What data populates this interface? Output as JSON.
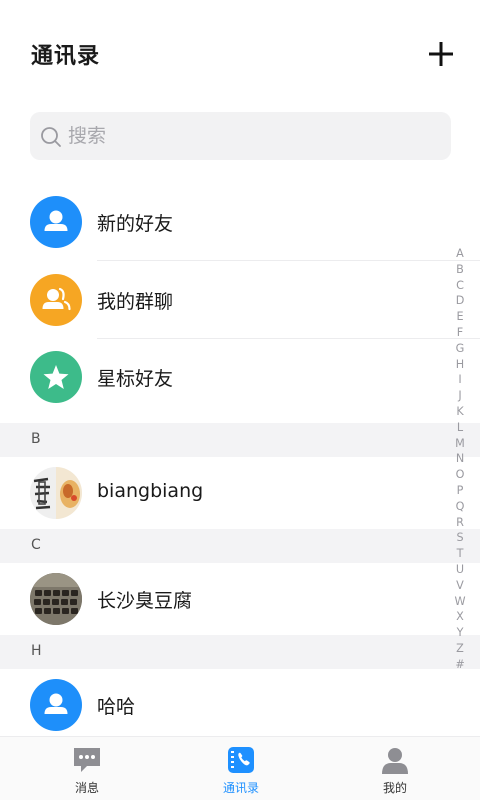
{
  "header": {
    "title": "通讯录"
  },
  "search": {
    "placeholder": "搜索"
  },
  "fixed_items": [
    {
      "label": "新的好友",
      "color": "#1e8ffa"
    },
    {
      "label": "我的群聊",
      "color": "#f6a623"
    },
    {
      "label": "星标好友",
      "color": "#3dbb8a"
    }
  ],
  "sections": [
    {
      "letter": "B",
      "contacts": [
        {
          "name": "biangbiang"
        }
      ]
    },
    {
      "letter": "C",
      "contacts": [
        {
          "name": "长沙臭豆腐"
        }
      ]
    },
    {
      "letter": "H",
      "contacts": [
        {
          "name": "哈哈"
        }
      ]
    }
  ],
  "index": [
    "A",
    "B",
    "C",
    "D",
    "E",
    "F",
    "G",
    "H",
    "I",
    "J",
    "K",
    "L",
    "M",
    "N",
    "O",
    "P",
    "Q",
    "R",
    "S",
    "T",
    "U",
    "V",
    "W",
    "X",
    "Y",
    "Z",
    "#"
  ],
  "tabbar": [
    {
      "label": "消息",
      "icon": "chat-icon",
      "active": false
    },
    {
      "label": "通讯录",
      "icon": "contacts-book-icon",
      "active": true
    },
    {
      "label": "我的",
      "icon": "person-icon",
      "active": false
    }
  ],
  "colors": {
    "accent": "#1e90ff",
    "inactive_icon": "#8e8e93"
  }
}
